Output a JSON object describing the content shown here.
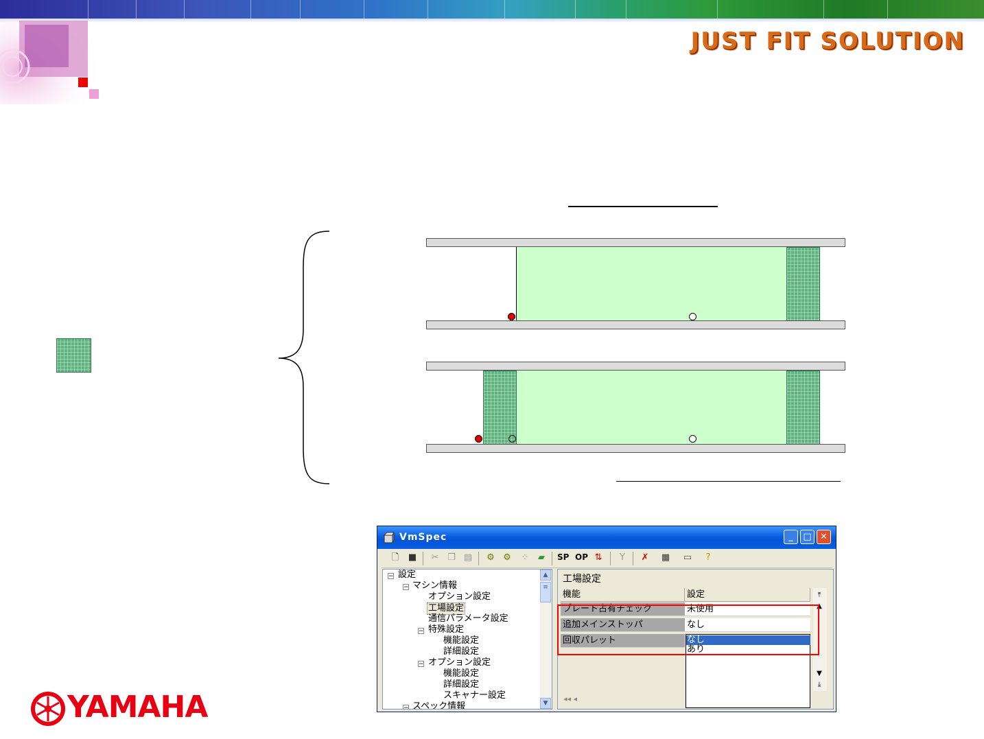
{
  "header": {
    "brand_title": "JUST FIT SOLUTION",
    "colors": {
      "band_start": "#2c2c9a",
      "band_end": "#1f7a25",
      "brand_title": "#d96a18"
    }
  },
  "diagram": {
    "colors": {
      "board": "#ccffcc",
      "pallet": "#5fb37e",
      "rail": "#dcdcdc",
      "stopper": "#e00000",
      "sensor": "#ffffff"
    },
    "icons": [
      "pallet-legend-icon",
      "brace-icon",
      "stopper-dot-icon",
      "sensor-dot-icon"
    ]
  },
  "vmspec": {
    "title": "VmSpec",
    "toolbar": {
      "sp_label": "SP",
      "op_label": "OP",
      "icons": [
        "new-file-icon",
        "save-icon",
        "cut-icon",
        "copy-icon",
        "paste-icon",
        "gear-icon",
        "gear-check-icon",
        "grid-icon",
        "board-icon",
        "transfer-icon",
        "nozzle-icon",
        "disconnect-icon",
        "chip-icon",
        "keyboard-icon",
        "help-icon"
      ]
    },
    "tree": {
      "items": [
        {
          "label": "設定",
          "level": 0,
          "toggle": "−"
        },
        {
          "label": "マシン情報",
          "level": 1,
          "toggle": "−"
        },
        {
          "label": "オプション設定",
          "level": 2
        },
        {
          "label": "工場設定",
          "level": 2,
          "selected": true
        },
        {
          "label": "通信パラメータ設定",
          "level": 2
        },
        {
          "label": "特殊設定",
          "level": 2,
          "toggle": "−"
        },
        {
          "label": "機能設定",
          "level": 3
        },
        {
          "label": "詳細設定",
          "level": 3
        },
        {
          "label": "オプション設定",
          "level": 2,
          "toggle": "−"
        },
        {
          "label": "機能設定",
          "level": 3
        },
        {
          "label": "詳細設定",
          "level": 3
        },
        {
          "label": "スキャナー設定",
          "level": 3
        },
        {
          "label": "スペック情報",
          "level": 1,
          "toggle": "−"
        }
      ]
    },
    "panel": {
      "title": "工場設定",
      "columns": [
        "機能",
        "設定"
      ],
      "rows": [
        {
          "label": "プレート占有チェック",
          "value": "未使用"
        },
        {
          "label": "追加メインストッパ",
          "value": "なし"
        },
        {
          "label": "回収パレット",
          "value": "なし"
        }
      ],
      "dropdown_options": [
        "なし",
        "あり"
      ],
      "dropdown_selected": "なし"
    }
  },
  "footer": {
    "logo_text": "YAMAHA",
    "logo_color": "#e60012"
  }
}
